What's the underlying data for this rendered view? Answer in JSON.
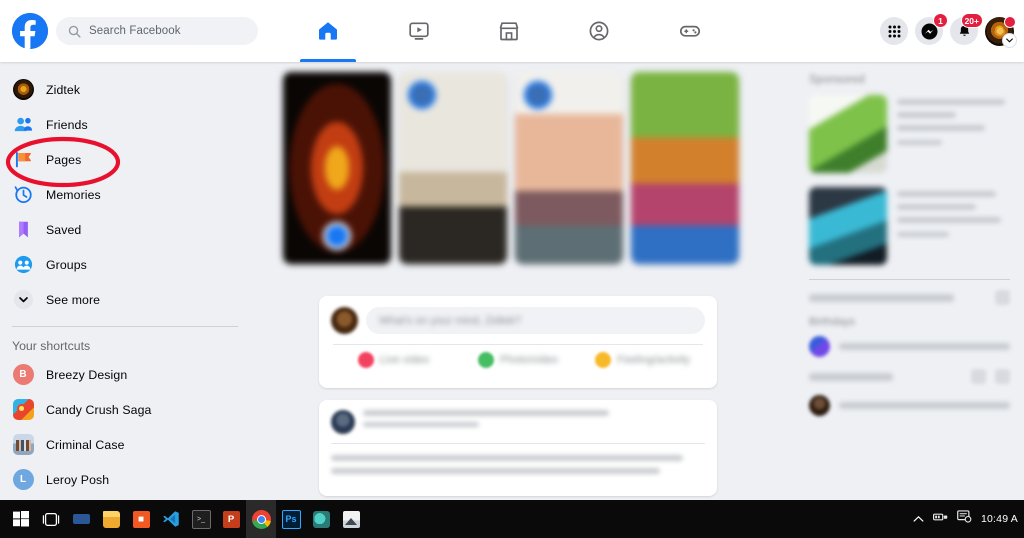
{
  "app": {
    "name": "Facebook",
    "browser": "Google Chrome"
  },
  "topbar": {
    "logo_icon": "facebook-logo-icon",
    "search": {
      "placeholder": "Search Facebook",
      "value": "",
      "icon": "search-icon"
    },
    "nav_tabs": [
      {
        "name": "home",
        "icon": "home-icon",
        "active": true
      },
      {
        "name": "watch",
        "icon": "video-screen-icon",
        "active": false
      },
      {
        "name": "marketplace",
        "icon": "storefront-icon",
        "active": false
      },
      {
        "name": "groups",
        "icon": "groups-people-icon",
        "active": false
      },
      {
        "name": "gaming",
        "icon": "gamepad-icon",
        "active": false
      }
    ],
    "actions": [
      {
        "name": "menu",
        "icon": "grid-apps-icon",
        "badge": ""
      },
      {
        "name": "messenger",
        "icon": "messenger-icon",
        "badge": "1"
      },
      {
        "name": "notifications",
        "icon": "bell-icon",
        "badge": "20+"
      }
    ],
    "account": {
      "name": "account-avatar",
      "icon": "lion-avatar-icon",
      "chevron": "chevron-down-icon",
      "has_dot": true
    }
  },
  "sidebar": {
    "items": [
      {
        "label": "Zidtek",
        "icon": "profile-avatar-icon"
      },
      {
        "label": "Friends",
        "icon": "friends-icon"
      },
      {
        "label": "Pages",
        "icon": "pages-flag-icon",
        "highlighted": true
      },
      {
        "label": "Memories",
        "icon": "clock-memories-icon"
      },
      {
        "label": "Saved",
        "icon": "bookmark-saved-icon"
      },
      {
        "label": "Groups",
        "icon": "groups-icon"
      },
      {
        "label": "See more",
        "icon": "chevron-down-icon"
      }
    ],
    "shortcuts_heading": "Your shortcuts",
    "shortcuts": [
      {
        "label": "Breezy Design",
        "icon": "letter-avatar-b",
        "initial": "B",
        "color": "#eb7b72"
      },
      {
        "label": "Candy Crush Saga",
        "icon": "candy-crush-icon"
      },
      {
        "label": "Criminal Case",
        "icon": "criminal-case-icon"
      },
      {
        "label": "Leroy Posh",
        "icon": "letter-avatar-l",
        "initial": "L",
        "color": "#6fa8e0"
      }
    ]
  },
  "annotation": {
    "shape": "ellipse",
    "color": "#e8112d",
    "target": "Pages",
    "stroke_width": 4
  },
  "feed": {
    "stories_count": 4,
    "composer": {
      "placeholder_blurred": true,
      "actions_count": 3
    },
    "post_count": 1
  },
  "rightbar": {
    "sponsored_heading_blurred": true,
    "ads_count": 2,
    "sections_blurred": true
  },
  "taskbar": {
    "items": [
      {
        "name": "start-button",
        "icon": "windows-logo-icon"
      },
      {
        "name": "task-view",
        "icon": "task-view-icon"
      },
      {
        "name": "search",
        "icon": "search-bar-icon"
      },
      {
        "name": "file-explorer",
        "icon": "folder-icon"
      },
      {
        "name": "app-orange",
        "icon": "orange-app-icon"
      },
      {
        "name": "vs-code",
        "icon": "vscode-icon"
      },
      {
        "name": "terminal",
        "icon": "terminal-icon"
      },
      {
        "name": "powerpoint",
        "icon": "powerpoint-icon"
      },
      {
        "name": "chrome",
        "icon": "chrome-icon",
        "active": true
      },
      {
        "name": "photoshop",
        "icon": "photoshop-icon"
      },
      {
        "name": "app-teal",
        "icon": "teal-app-icon"
      },
      {
        "name": "photos",
        "icon": "photos-icon"
      }
    ],
    "tray": {
      "overflow_icon": "chevron-up-icon",
      "network_icon": "network-icon",
      "action_center_icon": "action-center-icon",
      "time": "10:49 A"
    }
  }
}
